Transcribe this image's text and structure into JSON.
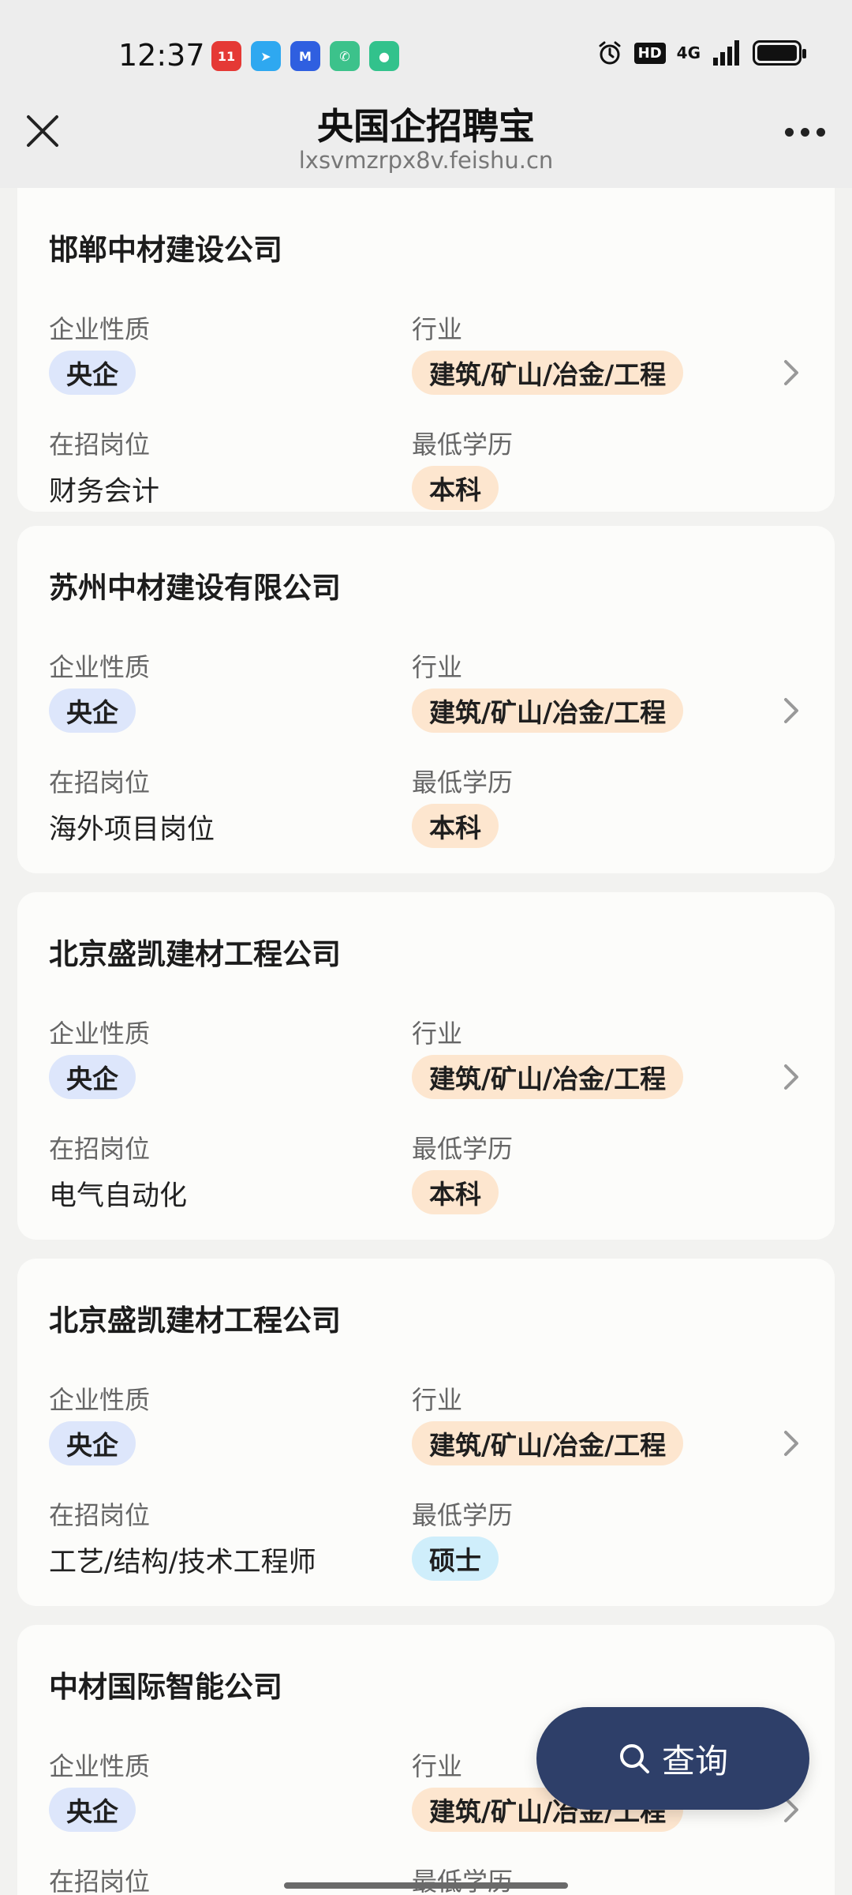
{
  "status_bar": {
    "time": "12:37",
    "apps": [
      {
        "name": "shopping-app-icon",
        "color": "#e53935",
        "glyph": "11"
      },
      {
        "name": "send-app-icon",
        "color": "#2ea8f0",
        "glyph": "➤"
      },
      {
        "name": "jd-app-icon",
        "color": "#2f5fe0",
        "glyph": "M"
      },
      {
        "name": "phone-app-icon",
        "color": "#3cc28b",
        "glyph": "✆"
      },
      {
        "name": "chat-app-icon",
        "color": "#32c28c",
        "glyph": "●"
      }
    ],
    "hd": "HD",
    "network": "4G"
  },
  "header": {
    "title": "央国企招聘宝",
    "url": "lxsvmzrpx8v.feishu.cn"
  },
  "labels": {
    "nature": "企业性质",
    "industry": "行业",
    "position": "在招岗位",
    "education": "最低学历"
  },
  "cards": [
    {
      "company": "邯郸中材建设公司",
      "nature": "央企",
      "industry": "建筑/矿山/冶金/工程",
      "position": "财务会计",
      "education": "本科",
      "edu_color": "orange"
    },
    {
      "company": "苏州中材建设有限公司",
      "nature": "央企",
      "industry": "建筑/矿山/冶金/工程",
      "position": "海外项目岗位",
      "education": "本科",
      "edu_color": "orange"
    },
    {
      "company": "北京盛凯建材工程公司",
      "nature": "央企",
      "industry": "建筑/矿山/冶金/工程",
      "position": "电气自动化",
      "education": "本科",
      "edu_color": "orange"
    },
    {
      "company": "北京盛凯建材工程公司",
      "nature": "央企",
      "industry": "建筑/矿山/冶金/工程",
      "position": "工艺/结构/技术工程师",
      "education": "硕士",
      "edu_color": "cyan"
    },
    {
      "company": "中材国际智能公司",
      "nature": "央企",
      "industry": "建筑/矿山/冶金/工程",
      "position": "",
      "education": "",
      "edu_color": "cyan"
    }
  ],
  "fab": {
    "label": "查询"
  }
}
